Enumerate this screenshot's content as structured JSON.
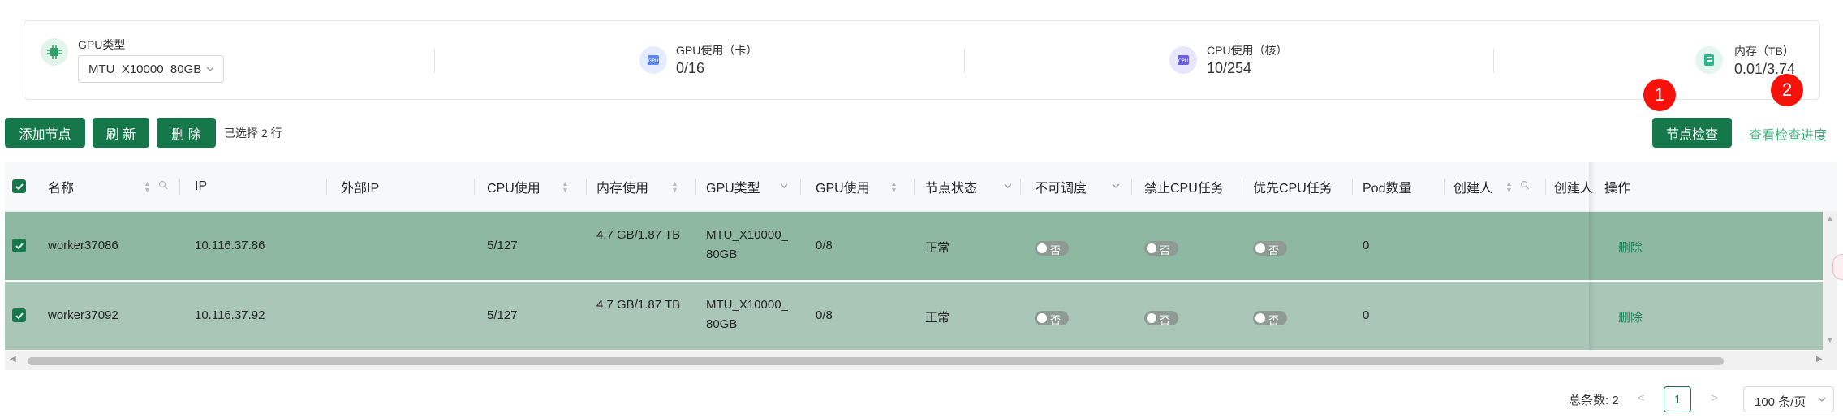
{
  "colors": {
    "primary": "#16784a",
    "selected_row": "#8fb8a3",
    "selected_row_2": "#a9c6b7",
    "badge": "#f5120a",
    "link": "#3fb07b"
  },
  "stats": {
    "gpu_type": {
      "label": "GPU类型",
      "value": "MTU_X10000_80GB",
      "icon": "chip-icon"
    },
    "gpu_usage": {
      "label": "GPU使用（卡）",
      "value": "0/16",
      "icon": "gpu-icon"
    },
    "cpu_usage": {
      "label": "CPU使用（核）",
      "value": "10/254",
      "icon": "cpu-icon"
    },
    "memory": {
      "label": "内存（TB）",
      "value": "0.01/3.74",
      "icon": "memory-card-icon"
    }
  },
  "toolbar": {
    "add_node": "添加节点",
    "refresh": "刷 新",
    "delete": "删 除",
    "selected_count": "已选择 2 行",
    "node_check": "节点检查",
    "check_progress": "查看检查进度"
  },
  "annotations": {
    "badge_1": "1",
    "badge_2": "2"
  },
  "table": {
    "columns": {
      "name": "名称",
      "ip": "IP",
      "external_ip": "外部IP",
      "cpu": "CPU使用",
      "memory": "内存使用",
      "gpu_type": "GPU类型",
      "gpu": "GPU使用",
      "node_status": "节点状态",
      "unschedulable": "不可调度",
      "no_cpu_task": "禁止CPU任务",
      "prefer_cpu_task": "优先CPU任务",
      "pod_count": "Pod数量",
      "creator": "创建人",
      "creator2": "创建人",
      "actions": "操作"
    },
    "rows": [
      {
        "name": "worker37086",
        "ip": "10.116.37.86",
        "external_ip": "",
        "cpu": "5/127",
        "memory": "4.7 GB/1.87 TB",
        "gpu_type": "MTU_X10000_80GB",
        "gpu": "0/8",
        "status": "正常",
        "unschedulable": "否",
        "no_cpu_task": "否",
        "prefer_cpu_task": "否",
        "pod_count": "0",
        "action": "删除"
      },
      {
        "name": "worker37092",
        "ip": "10.116.37.92",
        "external_ip": "",
        "cpu": "5/127",
        "memory": "4.7 GB/1.87 TB",
        "gpu_type": "MTU_X10000_80GB",
        "gpu": "0/8",
        "status": "正常",
        "unschedulable": "否",
        "no_cpu_task": "否",
        "prefer_cpu_task": "否",
        "pod_count": "0",
        "action": "删除"
      }
    ]
  },
  "pagination": {
    "total": "总条数: 2",
    "current_page": "1",
    "page_size": "100 条/页"
  }
}
